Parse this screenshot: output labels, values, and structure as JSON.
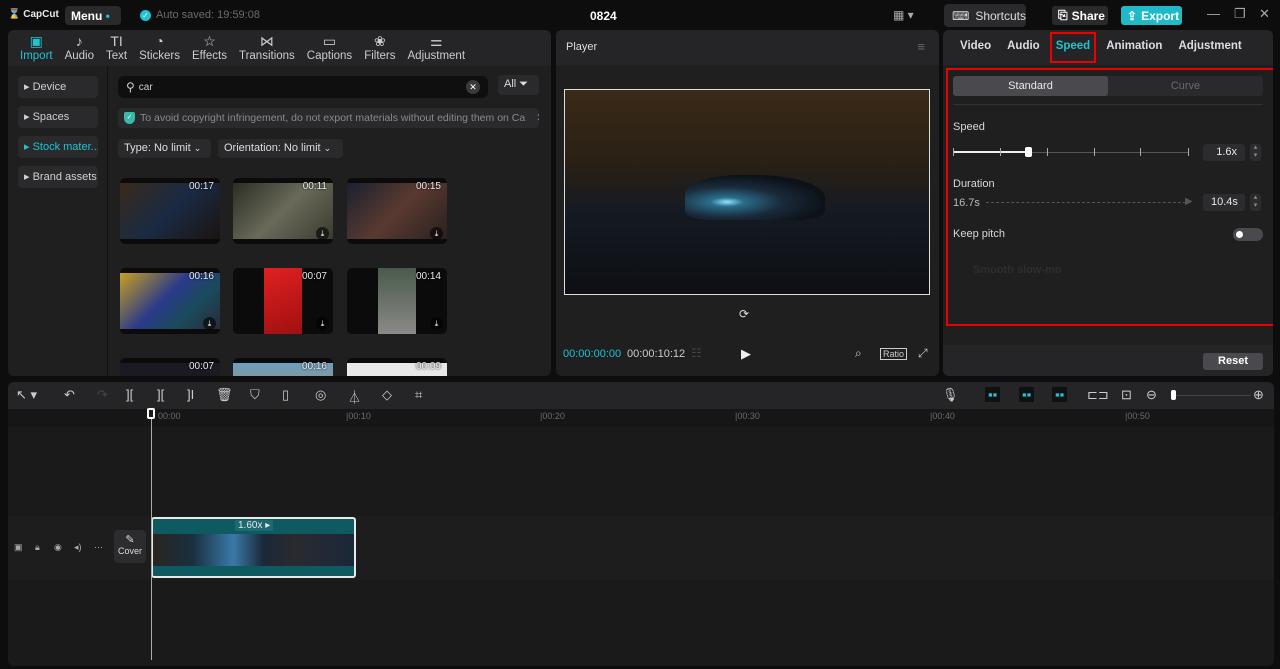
{
  "titlebar": {
    "app_name": "CapCut",
    "menu_label": "Menu",
    "autosave": "Auto saved: 19:59:08",
    "project_title": "0824",
    "shortcuts_label": "Shortcuts",
    "share_label": "Share",
    "export_label": "Export",
    "accent_color": "#1fc3d1"
  },
  "media_tabs": [
    {
      "label": "Import",
      "icon": "import-icon",
      "active": true
    },
    {
      "label": "Audio",
      "icon": "audio-icon"
    },
    {
      "label": "Text",
      "icon": "text-icon"
    },
    {
      "label": "Stickers",
      "icon": "stickers-icon"
    },
    {
      "label": "Effects",
      "icon": "effects-icon"
    },
    {
      "label": "Transitions",
      "icon": "transitions-icon"
    },
    {
      "label": "Captions",
      "icon": "captions-icon"
    },
    {
      "label": "Filters",
      "icon": "filters-icon"
    },
    {
      "label": "Adjustment",
      "icon": "adjustment-icon"
    }
  ],
  "sidebar": [
    {
      "label": "Device"
    },
    {
      "label": "Spaces"
    },
    {
      "label": "Stock mater...",
      "active": true
    },
    {
      "label": "Brand assets"
    }
  ],
  "search": {
    "value": "car",
    "filter_label": "All"
  },
  "notice": "To avoid copyright infringement, do not export materials without editing them on Ca",
  "filters": {
    "type": "Type: No limit",
    "orientation": "Orientation: No limit"
  },
  "thumbnails": [
    {
      "duration": "00:17"
    },
    {
      "duration": "00:11"
    },
    {
      "duration": "00:15"
    },
    {
      "duration": "00:16"
    },
    {
      "duration": "00:07"
    },
    {
      "duration": "00:14"
    },
    {
      "duration": "00:07"
    },
    {
      "duration": "00:16"
    },
    {
      "duration": "00:09"
    }
  ],
  "player": {
    "title": "Player",
    "current_time": "00:00:00:00",
    "total_time": "00:00:10:12",
    "ratio_label": "Ratio"
  },
  "settings": {
    "tabs": [
      "Video",
      "Audio",
      "Speed",
      "Animation",
      "Adjustment"
    ],
    "active_tab": "Speed",
    "modes": [
      "Standard",
      "Curve"
    ],
    "speed_label": "Speed",
    "speed_value": "1.6x",
    "duration_label": "Duration",
    "duration_original": "16.7s",
    "duration_value": "10.4s",
    "keep_pitch_label": "Keep pitch",
    "keep_pitch_on": false,
    "smooth_label": "Smooth slow-mo",
    "reset_label": "Reset"
  },
  "timeline": {
    "ruler": [
      "00:00",
      "|00:10",
      "|00:20",
      "|00:30",
      "|00:40",
      "|00:50"
    ],
    "clip_speed": "1.60x",
    "cover_label": "Cover"
  }
}
